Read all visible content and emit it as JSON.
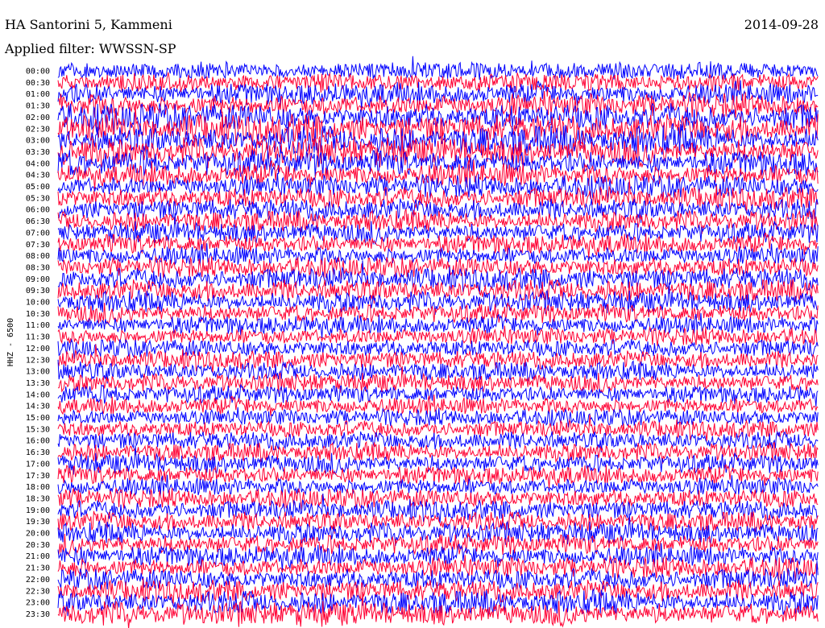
{
  "header": {
    "station": "HA Santorini 5, Kammeni",
    "date": "2014-09-28",
    "filter": "Applied filter: WWSSN-SP"
  },
  "chart_data": {
    "type": "line",
    "title": "HA Santorini 5, Kammeni",
    "ylabel": "HHZ - 6500",
    "row_labels": [
      "00:00",
      "00:30",
      "01:00",
      "01:30",
      "02:00",
      "02:30",
      "03:00",
      "03:30",
      "04:00",
      "04:30",
      "05:00",
      "05:30",
      "06:00",
      "06:30",
      "07:00",
      "07:30",
      "08:00",
      "08:30",
      "09:00",
      "09:30",
      "10:00",
      "10:30",
      "11:00",
      "11:30",
      "12:00",
      "12:30",
      "13:00",
      "13:30",
      "14:00",
      "14:30",
      "15:00",
      "15:30",
      "16:00",
      "16:30",
      "17:00",
      "17:30",
      "18:00",
      "18:30",
      "19:00",
      "19:30",
      "20:00",
      "20:30",
      "21:00",
      "21:30",
      "22:00",
      "22:30",
      "23:00",
      "23:30"
    ],
    "trace_colors": [
      "#0000ff",
      "#ff0033"
    ],
    "activity": [
      0.35,
      0.45,
      0.6,
      0.7,
      0.8,
      0.85,
      0.85,
      0.8,
      0.75,
      0.7,
      0.6,
      0.55,
      0.55,
      0.5,
      0.5,
      0.5,
      0.5,
      0.5,
      0.55,
      0.55,
      0.5,
      0.45,
      0.45,
      0.4,
      0.4,
      0.4,
      0.4,
      0.4,
      0.4,
      0.4,
      0.35,
      0.35,
      0.4,
      0.4,
      0.45,
      0.45,
      0.45,
      0.45,
      0.45,
      0.45,
      0.5,
      0.5,
      0.55,
      0.55,
      0.55,
      0.55,
      0.6,
      0.6
    ],
    "grid": false
  }
}
